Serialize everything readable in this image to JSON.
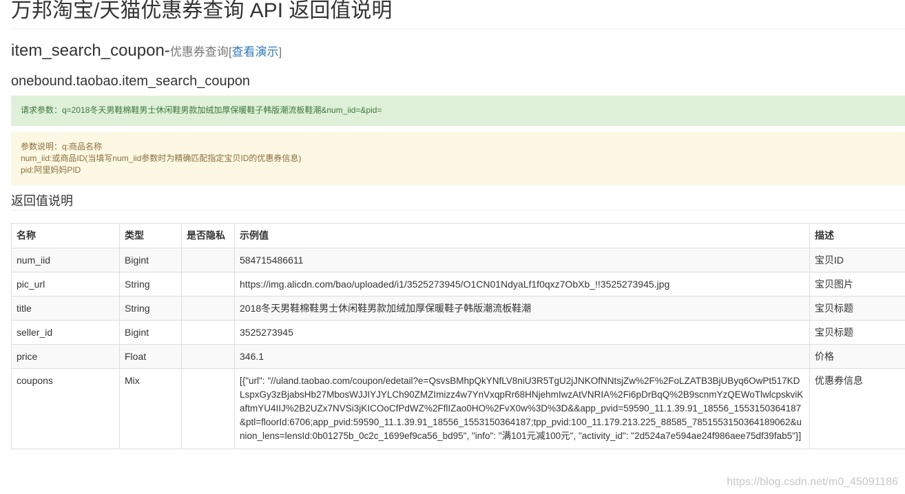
{
  "page_title": "万邦淘宝/天猫优惠券查询 API 返回值说明",
  "api_heading": {
    "name": "item_search_coupon-",
    "sub": "优惠券查询",
    "bracket_open": "[",
    "demo_link": "查看演示",
    "bracket_close": "]"
  },
  "api_method": "onebound.taobao.item_search_coupon",
  "request_params": "请求参数：q=2018冬天男鞋棉鞋男士休闲鞋男款加绒加厚保暖鞋子韩版潮流板鞋潮&num_iid=&pid=",
  "param_desc": {
    "line1": "参数说明：q:商品名称",
    "line2": "num_iid:或商品ID(当填写num_iid参数时为精确匹配指定宝贝ID的优惠券信息)",
    "line3": "pid:阿里妈妈PID"
  },
  "section_title": "返回值说明",
  "table": {
    "headers": [
      "名称",
      "类型",
      "是否隐私",
      "示例值",
      "描述"
    ],
    "rows": [
      {
        "name": "num_iid",
        "type": "Bigint",
        "private": "",
        "example": "584715486611",
        "desc": "宝贝ID"
      },
      {
        "name": "pic_url",
        "type": "String",
        "private": "",
        "example": "https://img.alicdn.com/bao/uploaded/i1/3525273945/O1CN01NdyaLf1f0qxz7ObXb_!!3525273945.jpg",
        "desc": "宝贝图片"
      },
      {
        "name": "title",
        "type": "String",
        "private": "",
        "example": "2018冬天男鞋棉鞋男士休闲鞋男款加绒加厚保暖鞋子韩版潮流板鞋潮",
        "desc": "宝贝标题"
      },
      {
        "name": "seller_id",
        "type": "Bigint",
        "private": "",
        "example": "3525273945",
        "desc": "宝贝标题"
      },
      {
        "name": "price",
        "type": "Float",
        "private": "",
        "example": "346.1",
        "desc": "价格"
      },
      {
        "name": "coupons",
        "type": "Mix",
        "private": "",
        "example": "[{\"url\": \"//uland.taobao.com/coupon/edetail?e=QsvsBMhpQkYNfLV8niU3R5TgU2jJNKOfNNtsjZw%2F%2FoLZATB3BjUByq6OwPt517KDLspxGy3zBjabsHb27MbosWJJIYJYLCh90ZMZImizz4w7YnVxqpRr68HNjehmIwzAtVNRIA%2Fi6pDrBqQ%2B9scnmYzQEWoTlwlcpskviKaftmYU4IIJ%2B2UZx7NVSi3jKICOoCfPdWZ%2FflIZao0HO%2FvX0w%3D%3D&&app_pvid=59590_11.1.39.91_18556_1553150364187&ptl=floorId:6706;app_pvid:59590_11.1.39.91_18556_1553150364187;tpp_pvid:100_11.179.213.225_88585_7851553150364189062&union_lens=lensId:0b01275b_0c2c_1699ef9ca56_bd95\", \"info\": \"满101元减100元\", \"activity_id\": \"2d524a7e594ae24f986aee75df39fab5\"}]",
        "desc": "优惠券信息"
      }
    ]
  },
  "watermark": "https://blog.csdn.net/m0_45091186"
}
